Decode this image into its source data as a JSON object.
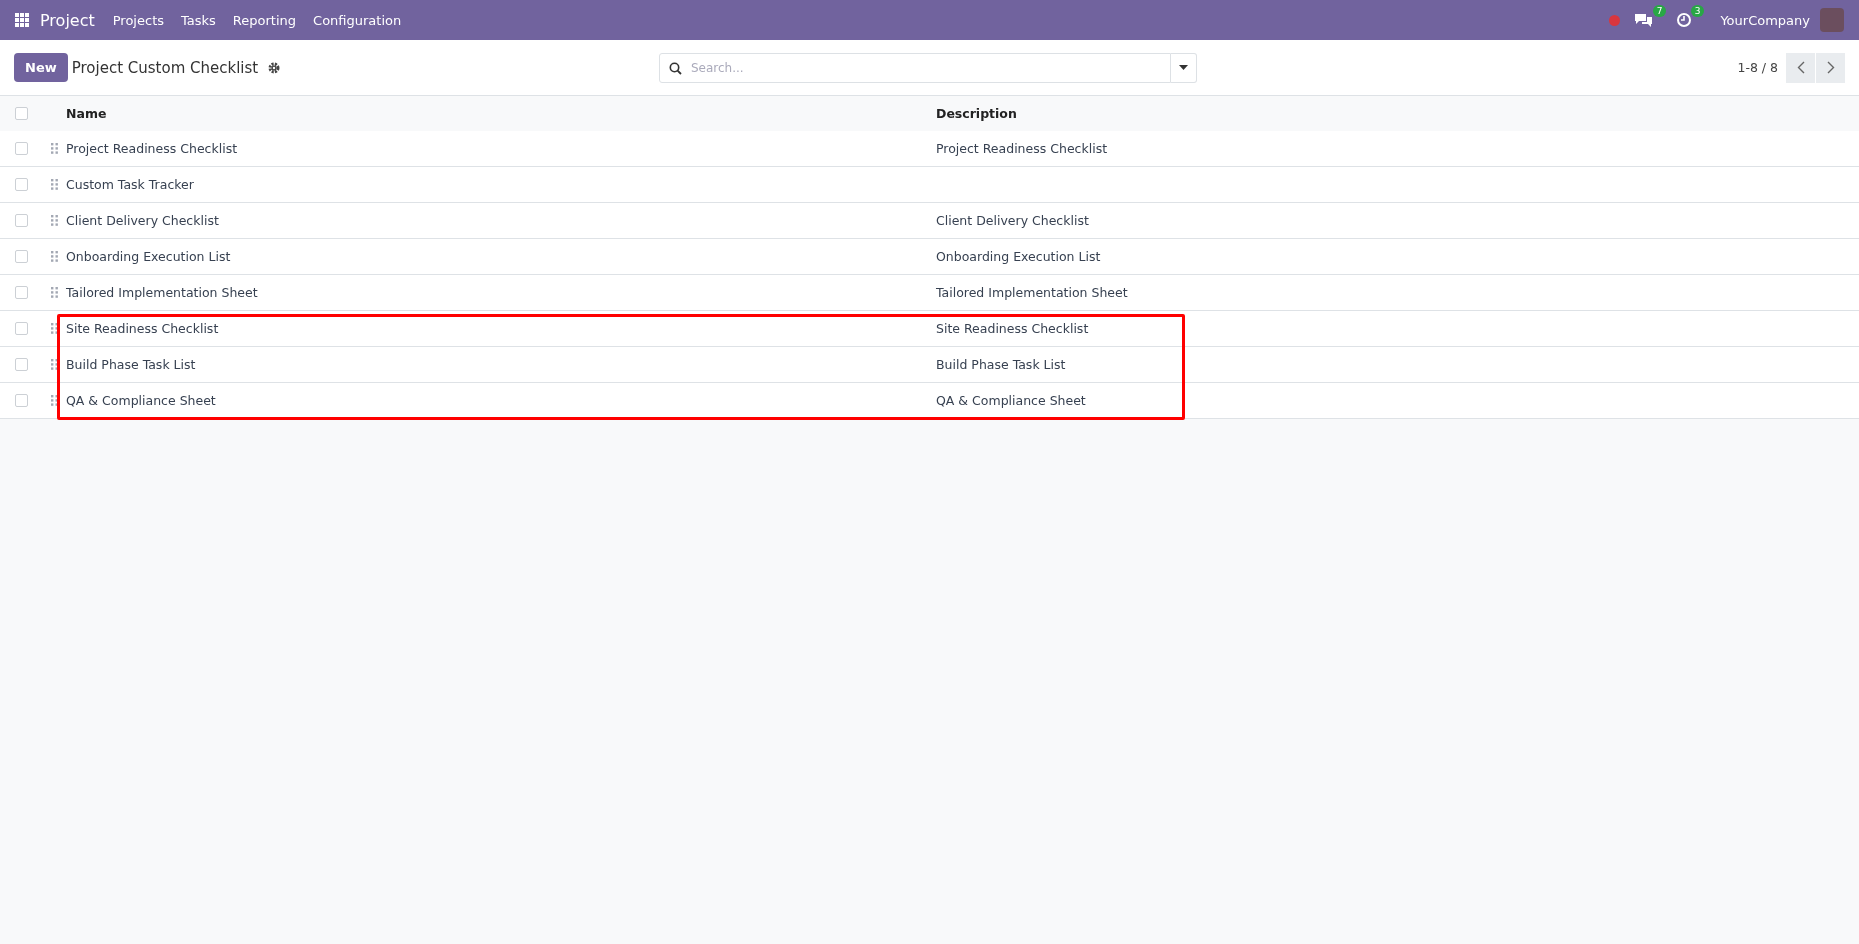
{
  "navbar": {
    "app": "Project",
    "menu": [
      "Projects",
      "Tasks",
      "Reporting",
      "Configuration"
    ],
    "messages_count": "7",
    "activities_count": "3",
    "company": "YourCompany"
  },
  "control_panel": {
    "new_button": "New",
    "title": "Project Custom Checklist",
    "search": {
      "placeholder": "Search..."
    },
    "pager": "1-8 / 8"
  },
  "table": {
    "select_all_checked": false,
    "columns": [
      "Name",
      "Description"
    ],
    "rows": [
      {
        "name": "Project Readiness Checklist",
        "description": "Project Readiness Checklist",
        "checked": false,
        "highlighted": false
      },
      {
        "name": "Custom Task Tracker",
        "checked": false,
        "highlighted": false
      },
      {
        "name": "Client Delivery Checklist",
        "description": "Client Delivery Checklist",
        "checked": false,
        "highlighted": false
      },
      {
        "name": "Onboarding Execution List",
        "description": "Onboarding Execution List",
        "checked": false,
        "highlighted": false
      },
      {
        "name": "Tailored Implementation Sheet",
        "description": "Tailored Implementation Sheet",
        "checked": false,
        "highlighted": false
      },
      {
        "name": "Site Readiness Checklist",
        "description": "Site Readiness Checklist",
        "checked": false,
        "highlighted": true
      },
      {
        "name": "Build Phase Task List",
        "description": "Build Phase Task List",
        "checked": false,
        "highlighted": true
      },
      {
        "name": "QA & Compliance Sheet",
        "description": "QA & Compliance Sheet",
        "checked": false,
        "highlighted": true
      }
    ]
  }
}
